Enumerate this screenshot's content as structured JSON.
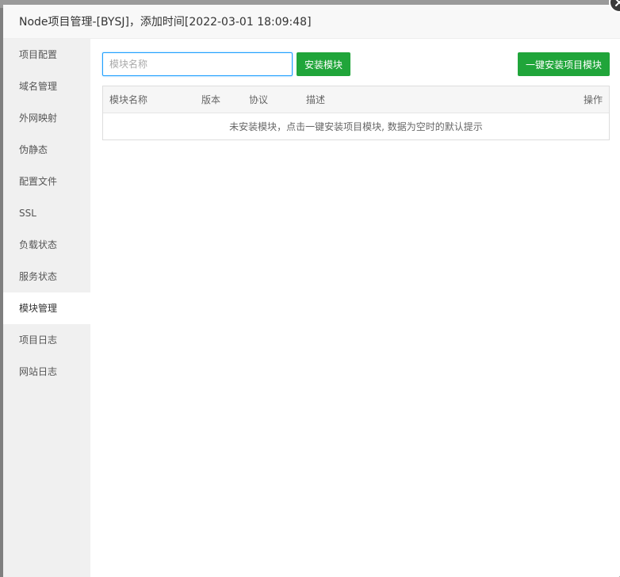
{
  "dialog": {
    "title": "Node项目管理-[BYSJ]，添加时间[2022-03-01 18:09:48]",
    "close_icon": "close-icon"
  },
  "sidebar": {
    "items": [
      {
        "label": "项目配置"
      },
      {
        "label": "域名管理"
      },
      {
        "label": "外网映射"
      },
      {
        "label": "伪静态"
      },
      {
        "label": "配置文件"
      },
      {
        "label": "SSL"
      },
      {
        "label": "负载状态"
      },
      {
        "label": "服务状态"
      },
      {
        "label": "模块管理",
        "active": true
      },
      {
        "label": "项目日志"
      },
      {
        "label": "网站日志"
      }
    ]
  },
  "toolbar": {
    "search_placeholder": "模块名称",
    "install_label": "安装模块",
    "onekey_label": "一键安装项目模块"
  },
  "table": {
    "columns": [
      "模块名称",
      "版本",
      "协议",
      "描述",
      "操作"
    ],
    "empty_text": "未安装模块，点击一键安装项目模块, 数据为空时的默认提示"
  },
  "colors": {
    "accent_green": "#20a53a",
    "focus_blue": "#1e9fff"
  }
}
